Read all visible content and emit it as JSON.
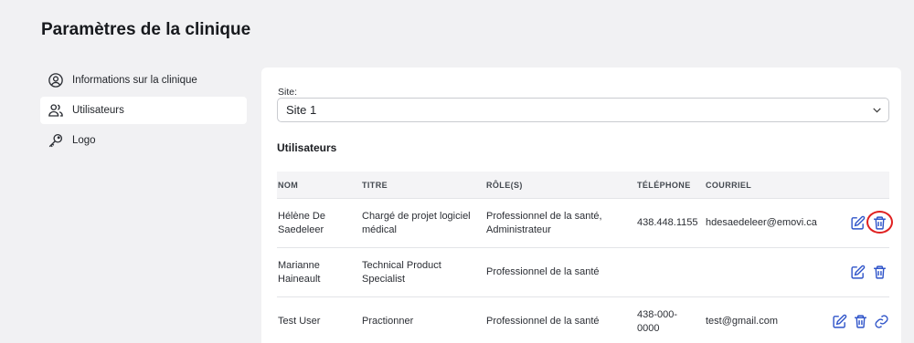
{
  "page": {
    "title": "Paramètres de la clinique"
  },
  "sidebar": {
    "items": [
      {
        "label": "Informations sur la clinique",
        "icon": "user-circle-icon",
        "active": false
      },
      {
        "label": "Utilisateurs",
        "icon": "users-icon",
        "active": true
      },
      {
        "label": "Logo",
        "icon": "key-icon",
        "active": false
      }
    ]
  },
  "site": {
    "label": "Site:",
    "value": "Site 1"
  },
  "users_section": {
    "title": "Utilisateurs",
    "columns": {
      "nom": "NOM",
      "titre": "TITRE",
      "roles": "RÔLE(S)",
      "telephone": "TÉLÉPHONE",
      "courriel": "COURRIEL"
    },
    "rows": [
      {
        "nom": "Hélène De Saedeleer",
        "titre": "Chargé de projet logiciel médical",
        "roles": "Professionnel de la santé, Administrateur",
        "telephone": "438.448.1155",
        "courriel": "hdesaedeleer@emovi.ca",
        "actions": [
          "edit-icon",
          "trash-icon"
        ]
      },
      {
        "nom": "Marianne Haineault",
        "titre": "Technical Product Specialist",
        "roles": "Professionnel de la santé",
        "telephone": "",
        "courriel": "",
        "actions": [
          "edit-icon",
          "trash-icon"
        ]
      },
      {
        "nom": "Test User",
        "titre": "Practionner",
        "roles": "Professionnel de la santé",
        "telephone": "438-000-0000",
        "courriel": "test@gmail.com",
        "actions": [
          "edit-icon",
          "trash-icon",
          "link-icon"
        ]
      }
    ]
  },
  "colors": {
    "accent": "#2f54c9",
    "highlight": "#e02020",
    "background": "#f1f1f3"
  }
}
